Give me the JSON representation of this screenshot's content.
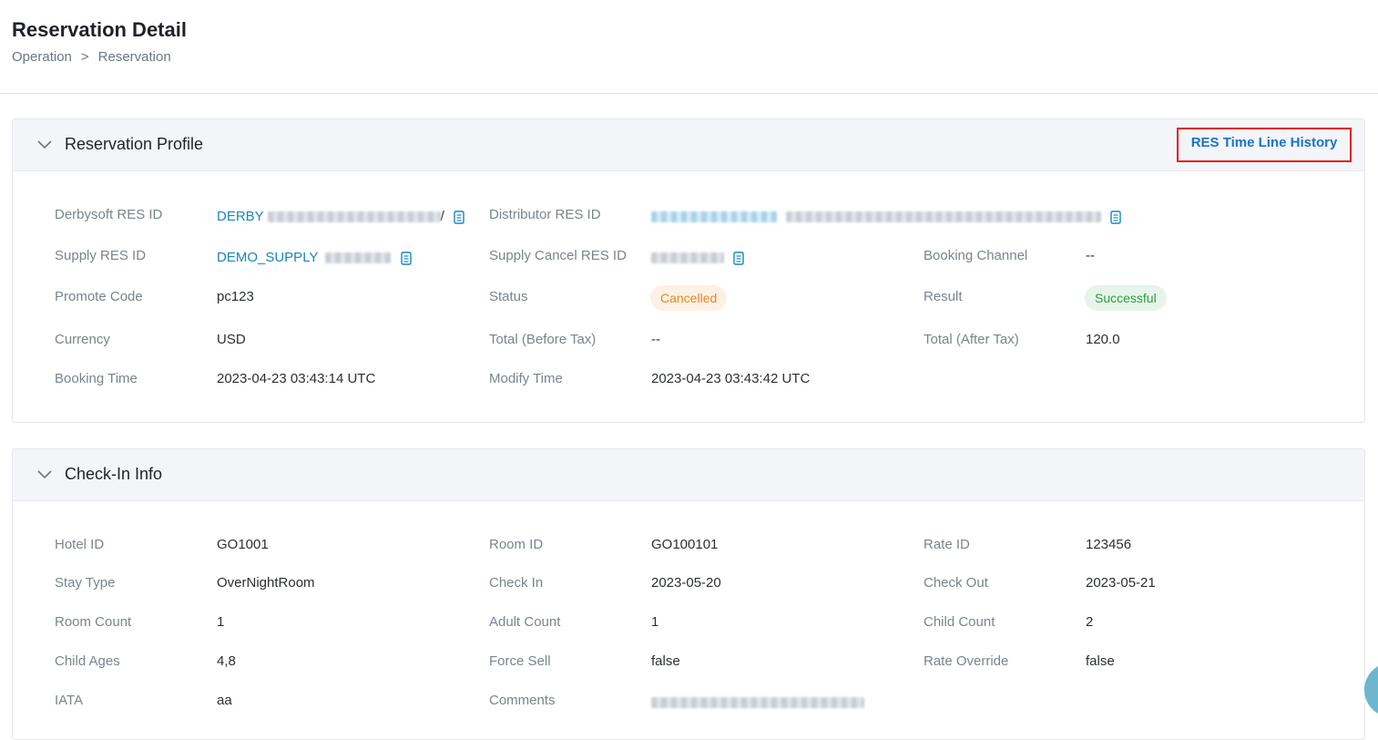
{
  "header": {
    "title": "Reservation Detail",
    "breadcrumb": [
      "Operation",
      ">",
      "Reservation"
    ]
  },
  "profile": {
    "title": "Reservation Profile",
    "timeline_link": "RES Time Line History",
    "labels": {
      "derbysoft_res_id": "Derbysoft RES ID",
      "distributor_res_id": "Distributor RES ID",
      "supply_res_id": "Supply RES ID",
      "supply_cancel_res_id": "Supply Cancel RES ID",
      "booking_channel": "Booking Channel",
      "promote_code": "Promote Code",
      "status": "Status",
      "result": "Result",
      "currency": "Currency",
      "total_before_tax": "Total (Before Tax)",
      "total_after_tax": "Total (After Tax)",
      "booking_time": "Booking Time",
      "modify_time": "Modify Time"
    },
    "values": {
      "derbysoft_res_id_prefix": "DERBY",
      "derbysoft_res_id_suffix": "/",
      "supply_res_id_prefix": "DEMO_SUPPLY",
      "booking_channel": "--",
      "promote_code": "pc123",
      "status": "Cancelled",
      "result": "Successful",
      "currency": "USD",
      "total_before_tax": "--",
      "total_after_tax": "120.0",
      "booking_time": "2023-04-23 03:43:14 UTC",
      "modify_time": "2023-04-23 03:43:42 UTC"
    },
    "colors": {
      "link": "#1787b8",
      "status": "#e08a1c",
      "result": "#2e9b41"
    }
  },
  "checkin": {
    "title": "Check-In Info",
    "labels": {
      "hotel_id": "Hotel ID",
      "room_id": "Room ID",
      "rate_id": "Rate ID",
      "stay_type": "Stay Type",
      "check_in": "Check In",
      "check_out": "Check Out",
      "room_count": "Room Count",
      "adult_count": "Adult Count",
      "child_count": "Child Count",
      "child_ages": "Child Ages",
      "force_sell": "Force Sell",
      "rate_override": "Rate Override",
      "iata": "IATA",
      "comments": "Comments"
    },
    "values": {
      "hotel_id": "GO1001",
      "room_id": "GO100101",
      "rate_id": "123456",
      "stay_type": "OverNightRoom",
      "check_in": "2023-05-20",
      "check_out": "2023-05-21",
      "room_count": "1",
      "adult_count": "1",
      "child_count": "2",
      "child_ages": "4,8",
      "force_sell": "false",
      "rate_override": "false",
      "iata": "aa"
    }
  },
  "icons": {
    "copy": "copy-icon",
    "collapse": "chevron-down-icon"
  }
}
